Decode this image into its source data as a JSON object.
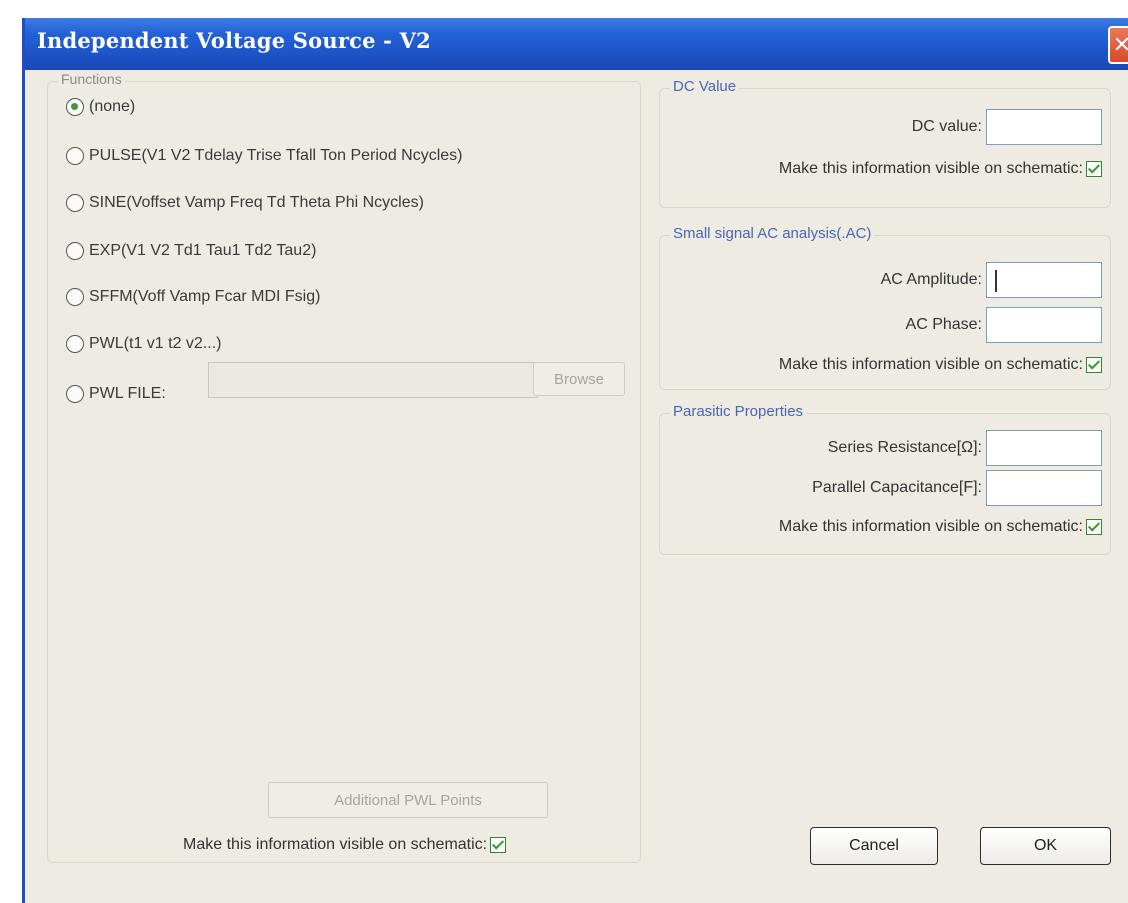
{
  "window": {
    "title": "Independent Voltage Source - V2",
    "close_label": "✕"
  },
  "functions": {
    "label": "Functions",
    "options": [
      {
        "label": "(none)",
        "checked": true
      },
      {
        "label": "PULSE(V1 V2 Tdelay Trise Tfall Ton Period Ncycles)",
        "checked": false
      },
      {
        "label": "SINE(Voffset Vamp Freq Td Theta Phi Ncycles)",
        "checked": false
      },
      {
        "label": "EXP(V1 V2 Td1 Tau1 Td2 Tau2)",
        "checked": false
      },
      {
        "label": "SFFM(Voff Vamp Fcar MDI Fsig)",
        "checked": false
      },
      {
        "label": "PWL(t1 v1 t2 v2...)",
        "checked": false
      },
      {
        "label": "PWL FILE:",
        "checked": false
      }
    ],
    "pwl_file_value": "",
    "browse_label": "Browse",
    "additional_pwl_label": "Additional PWL Points",
    "visible_label": "Make this information visible on schematic:",
    "visible_checked": true
  },
  "dc": {
    "label": "DC Value",
    "dc_value_label": "DC value:",
    "dc_value": "",
    "visible_label": "Make this information visible on schematic:",
    "visible_checked": true
  },
  "ac": {
    "label": "Small signal AC analysis(.AC)",
    "amplitude_label": "AC Amplitude:",
    "amplitude_value": "",
    "phase_label": "AC Phase:",
    "phase_value": "",
    "visible_label": "Make this information visible on schematic:",
    "visible_checked": true
  },
  "parasitic": {
    "label": "Parasitic Properties",
    "series_label": "Series Resistance[Ω]:",
    "series_value": "",
    "parallel_label": "Parallel Capacitance[F]:",
    "parallel_value": "",
    "visible_label": "Make this information visible on schematic:",
    "visible_checked": true
  },
  "buttons": {
    "cancel": "Cancel",
    "ok": "OK"
  },
  "colors": {
    "title_bar": "#2461d6",
    "group_label": "#4a66b5",
    "dialog_bg": "#eeebe3"
  }
}
